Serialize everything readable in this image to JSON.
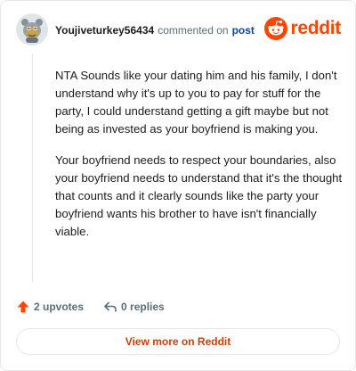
{
  "comment": {
    "username": "Youjiveturkey56434",
    "meta_text": "commented on",
    "post_link": "post",
    "paragraphs": [
      "NTA Sounds like your dating him and his family, I don't understand why it's up to you to pay for stuff for the party, I could understand getting a gift maybe but not being as invested as your boyfriend is making you.",
      "Your boyfriend needs to respect your boundaries, also your boyfriend needs to understand that it's the thought that counts and it clearly sounds like the party your boyfriend wants his brother to have isn't financially viable."
    ]
  },
  "brand": {
    "wordmark": "reddit",
    "color": "#ff4500",
    "icon": "reddit-snoo-icon"
  },
  "actions": {
    "upvotes_label": "2 upvotes",
    "replies_label": "0 replies",
    "upvote_icon": "upvote-arrow-icon",
    "reply_icon": "reply-arrow-icon",
    "upvote_color": "#ff4500"
  },
  "view_more_label": "View more on Reddit"
}
